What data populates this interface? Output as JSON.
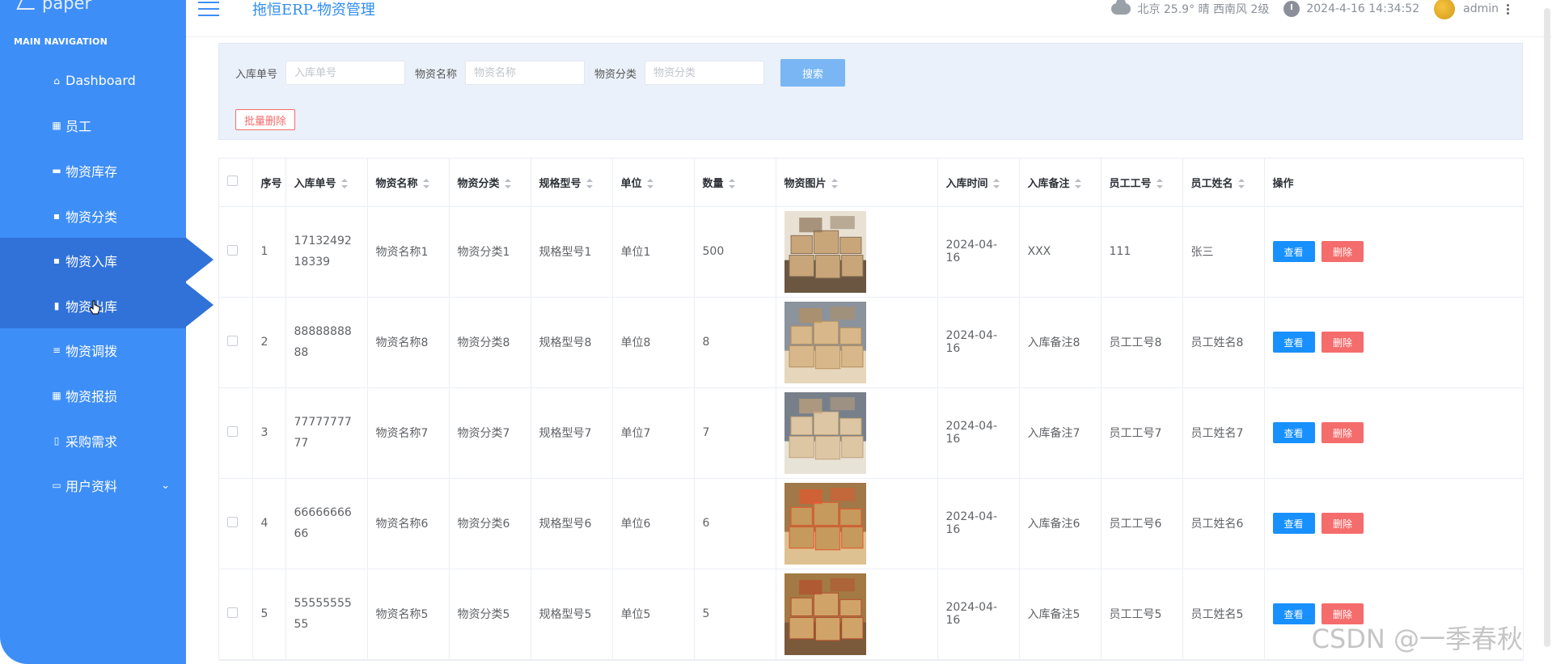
{
  "sidebar": {
    "logo_text": "paper",
    "nav_title": "MAIN NAVIGATION",
    "items": [
      {
        "label": "Dashboard",
        "icon": "⌂"
      },
      {
        "label": "员工",
        "icon": "▦"
      },
      {
        "label": "物资库存",
        "icon": "▬"
      },
      {
        "label": "物资分类",
        "icon": "▪"
      },
      {
        "label": "物资入库",
        "icon": "▪"
      },
      {
        "label": "物资出库",
        "icon": "▮"
      },
      {
        "label": "物资调拨",
        "icon": "≡"
      },
      {
        "label": "物资报损",
        "icon": "▦"
      },
      {
        "label": "采购需求",
        "icon": "▯"
      },
      {
        "label": "用户资料",
        "icon": "▭",
        "chevron": "⌄"
      }
    ]
  },
  "header": {
    "title": "拖恒ERP-物资管理",
    "weather": "北京  25.9°  晴  西南风  2级",
    "datetime": "2024-4-16 14:34:52",
    "user": "admin"
  },
  "search": {
    "fields": [
      {
        "label": "入库单号",
        "placeholder": "入库单号"
      },
      {
        "label": "物资名称",
        "placeholder": "物资名称"
      },
      {
        "label": "物资分类",
        "placeholder": "物资分类"
      }
    ],
    "search_button": "搜索",
    "batch_delete_button": "批量删除"
  },
  "table": {
    "headers": [
      "序号",
      "入库单号",
      "物资名称",
      "物资分类",
      "规格型号",
      "单位",
      "数量",
      "物资图片",
      "入库时间",
      "入库备注",
      "员工工号",
      "员工姓名",
      "操作"
    ],
    "view_label": "查看",
    "delete_label": "删除",
    "rows": [
      {
        "no": "1",
        "code": "1713249218339",
        "name": "物资名称1",
        "category": "物资分类1",
        "spec": "规格型号1",
        "unit": "单位1",
        "qty": "500",
        "date": "2024-04-16",
        "note": "XXX",
        "emp_no": "111",
        "emp_name": "张三"
      },
      {
        "no": "2",
        "code": "8888888888",
        "name": "物资名称8",
        "category": "物资分类8",
        "spec": "规格型号8",
        "unit": "单位8",
        "qty": "8",
        "date": "2024-04-16",
        "note": "入库备注8",
        "emp_no": "员工工号8",
        "emp_name": "员工姓名8"
      },
      {
        "no": "3",
        "code": "7777777777",
        "name": "物资名称7",
        "category": "物资分类7",
        "spec": "规格型号7",
        "unit": "单位7",
        "qty": "7",
        "date": "2024-04-16",
        "note": "入库备注7",
        "emp_no": "员工工号7",
        "emp_name": "员工姓名7"
      },
      {
        "no": "4",
        "code": "6666666666",
        "name": "物资名称6",
        "category": "物资分类6",
        "spec": "规格型号6",
        "unit": "单位6",
        "qty": "6",
        "date": "2024-04-16",
        "note": "入库备注6",
        "emp_no": "员工工号6",
        "emp_name": "员工姓名6"
      },
      {
        "no": "5",
        "code": "5555555555",
        "name": "物资名称5",
        "category": "物资分类5",
        "spec": "规格型号5",
        "unit": "单位5",
        "qty": "5",
        "date": "2024-04-16",
        "note": "入库备注5",
        "emp_no": "员工工号5",
        "emp_name": "员工姓名5"
      }
    ]
  },
  "watermark": "CSDN @一季春秋",
  "colors": {
    "sidebar": "#3e8ef7",
    "accent": "#2d8cf0",
    "danger": "#f56c6c",
    "primary_button": "#1890ff"
  }
}
